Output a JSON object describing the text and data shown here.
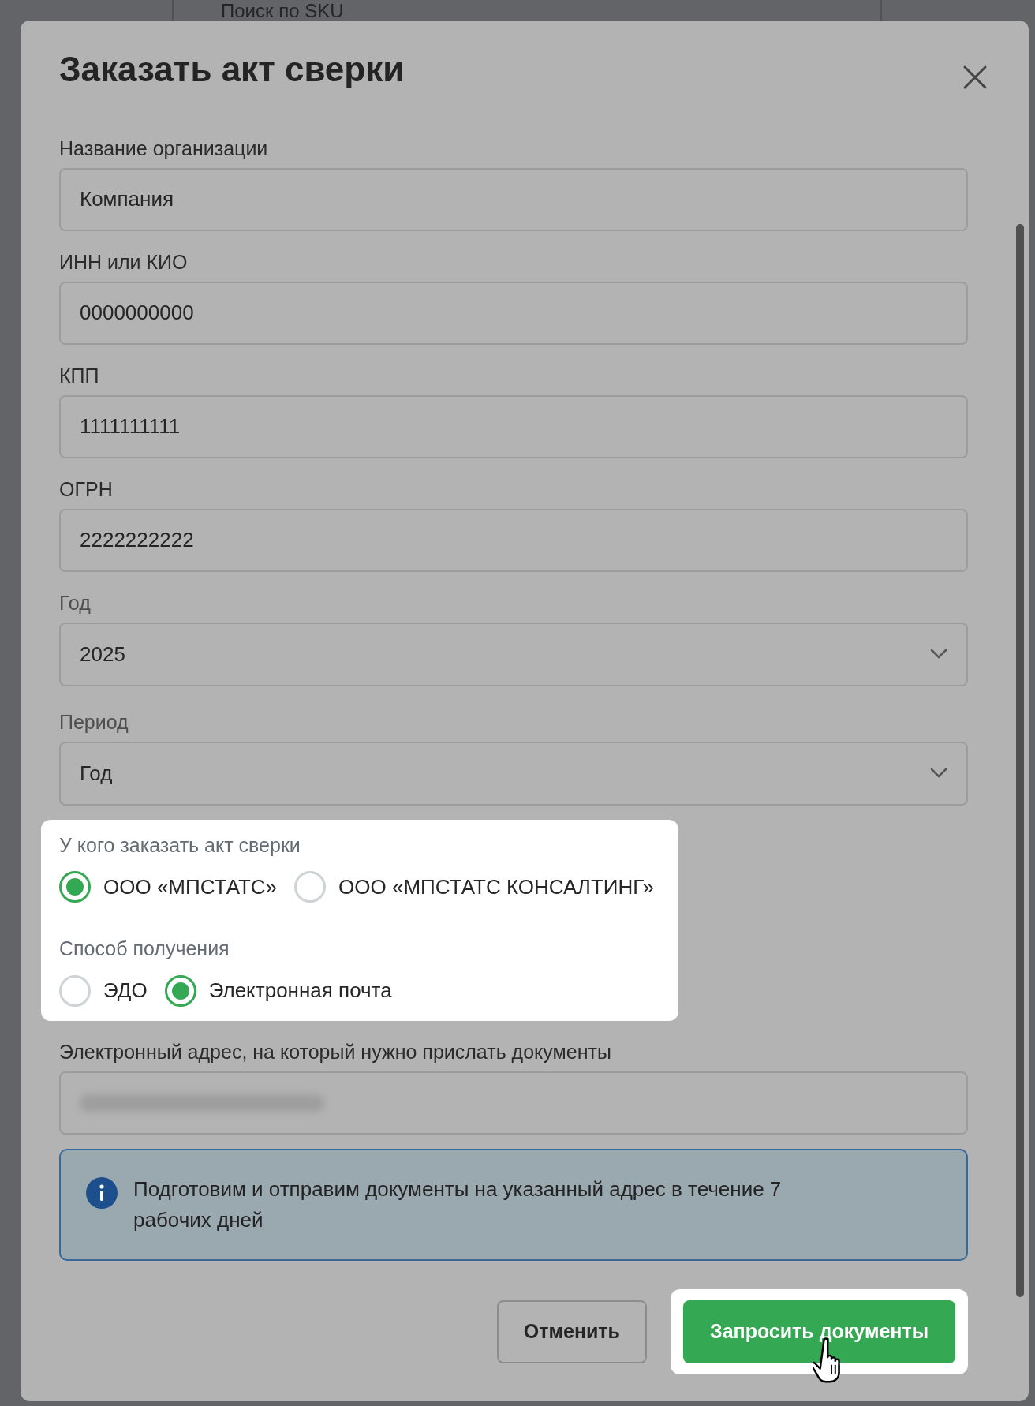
{
  "background": {
    "search_placeholder": "Поиск по SKU"
  },
  "dialog": {
    "title": "Заказать акт сверки"
  },
  "fields": [
    {
      "kind": "input",
      "label": "Название организации",
      "value": "Компания"
    },
    {
      "kind": "input",
      "label": "ИНН или КИО",
      "value": "0000000000"
    },
    {
      "kind": "input",
      "label": "КПП",
      "value": "1111111111"
    },
    {
      "kind": "input",
      "label": "ОГРН",
      "value": "2222222222"
    },
    {
      "kind": "select",
      "label": "Год",
      "value": "2025"
    },
    {
      "kind": "select",
      "label": "Период",
      "value": "Год"
    }
  ],
  "radio_groups": [
    {
      "label": "У кого заказать акт сверки",
      "options": [
        {
          "label": "ООО «МПСТАТС»",
          "selected": true
        },
        {
          "label": "ООО «МПСТАТС КОНСАЛТИНГ»",
          "selected": false
        }
      ]
    },
    {
      "label": "Способ получения",
      "options": [
        {
          "label": "ЭДО",
          "selected": false
        },
        {
          "label": "Электронная почта",
          "selected": true
        }
      ]
    }
  ],
  "email": {
    "label": "Электронный адрес, на который нужно прислать документы",
    "value_redacted": true
  },
  "info": {
    "text": "Подготовим и отправим документы на указанный адрес в течение 7 рабочих дней"
  },
  "buttons": [
    {
      "kind": "secondary",
      "label": "Отменить",
      "highlighted": false
    },
    {
      "kind": "primary",
      "label": "Запросить документы",
      "highlighted": true
    }
  ]
}
